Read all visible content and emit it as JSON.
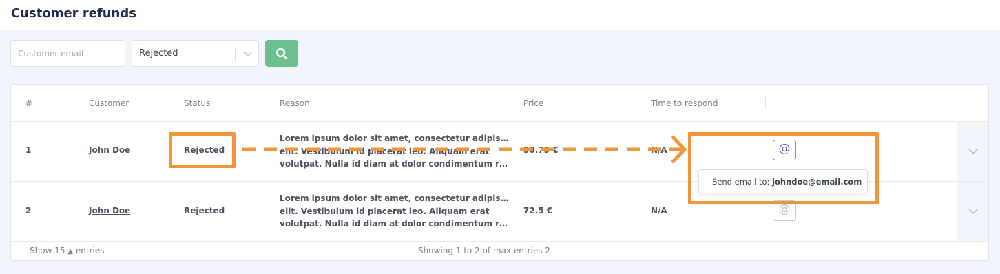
{
  "header": {
    "title": "Customer refunds"
  },
  "filters": {
    "email_placeholder": "Customer email",
    "status_value": "Rejected"
  },
  "table": {
    "columns": [
      "#",
      "Customer",
      "Status",
      "Reason",
      "Price",
      "Time to respond"
    ],
    "rows": [
      {
        "num": "1",
        "customer": "John Doe",
        "status": "Rejected",
        "reason_lines": [
          "Lorem ipsum dolor sit amet, consectetur adipiscing",
          "elit. Vestibulum id placerat leo. Aliquam erat",
          "volutpat. Nulla id diam at dolor condimentum rutrum"
        ],
        "price": "50.75 €",
        "time_to_respond": "N/A"
      },
      {
        "num": "2",
        "customer": "John Doe",
        "status": "Rejected",
        "reason_lines": [
          "Lorem ipsum dolor sit amet, consectetur adipiscing",
          "elit. Vestibulum id placerat leo. Aliquam erat",
          "volutpat. Nulla id diam at dolor condimentum rutrum"
        ],
        "price": "72.5 €",
        "time_to_respond": "N/A"
      }
    ]
  },
  "tooltip": {
    "prefix": "Send email to:",
    "email": "johndoe@email.com"
  },
  "footer": {
    "show_label": "Show",
    "show_count": "15",
    "entries_label": "entries",
    "summary": "Showing 1 to 2 of max entries 2"
  },
  "icons": {
    "at": "@",
    "search": "search-icon",
    "chevron": "chevron-down-icon",
    "caret_up": "▲"
  },
  "colors": {
    "accent_green": "#6cc08f",
    "annotation_orange": "#f1953a",
    "title_navy": "#1c2a4e"
  }
}
